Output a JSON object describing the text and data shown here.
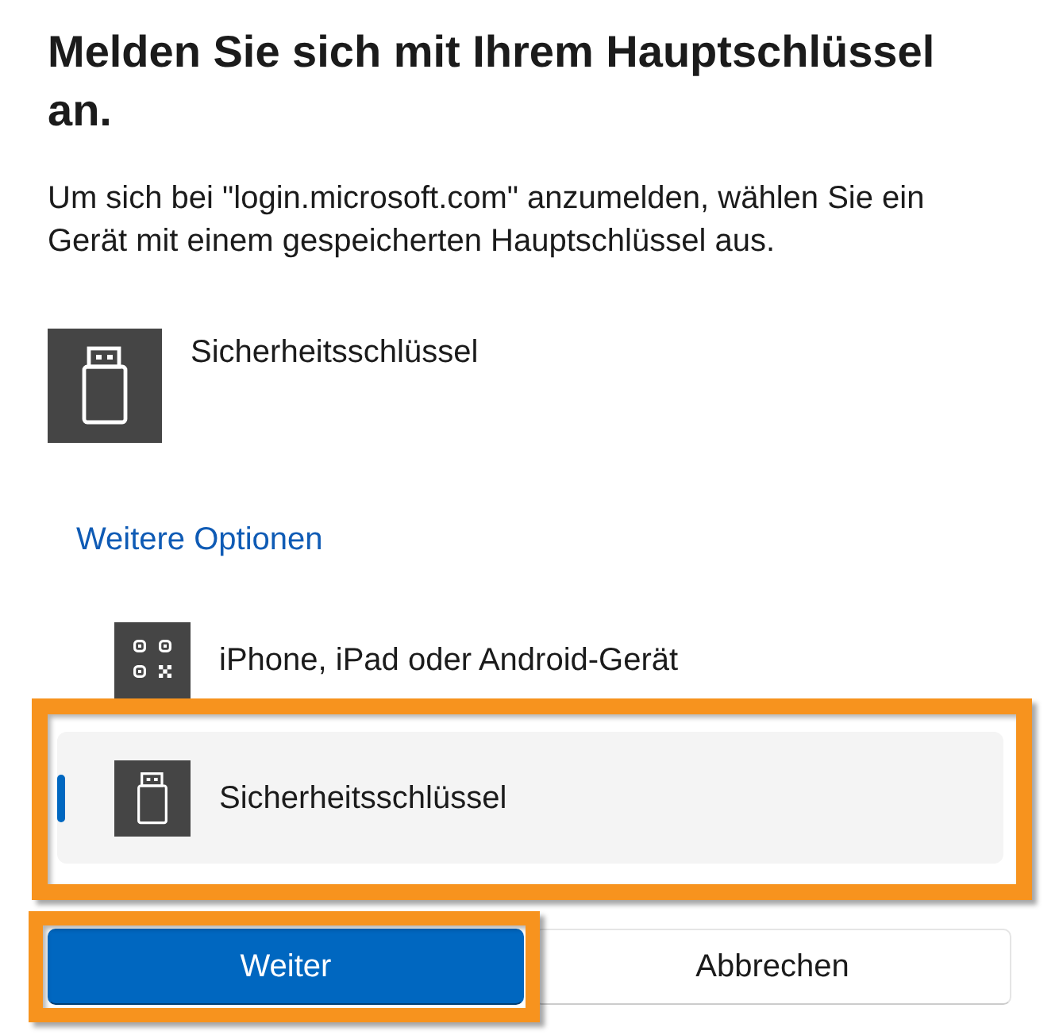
{
  "title": "Melden Sie sich mit Ihrem Hauptschlüssel an.",
  "description": "Um sich bei \"login.microsoft.com\" anzumelden, wählen Sie ein Gerät mit einem gespeicherten Hauptschlüssel aus.",
  "default_device": {
    "kind": "security-key",
    "label": "Sicherheitsschlüssel"
  },
  "more_options": {
    "label": "Weitere Optionen",
    "options": [
      {
        "kind": "phone",
        "label": "iPhone, iPad oder Android-Gerät",
        "selected": false,
        "highlighted": false
      },
      {
        "kind": "security-key",
        "label": "Sicherheitsschlüssel",
        "selected": true,
        "highlighted": true
      }
    ]
  },
  "buttons": [
    {
      "kind": "primary",
      "label": "Weiter",
      "highlighted": true
    },
    {
      "kind": "secondary",
      "label": "Abbrechen",
      "highlighted": false
    }
  ]
}
